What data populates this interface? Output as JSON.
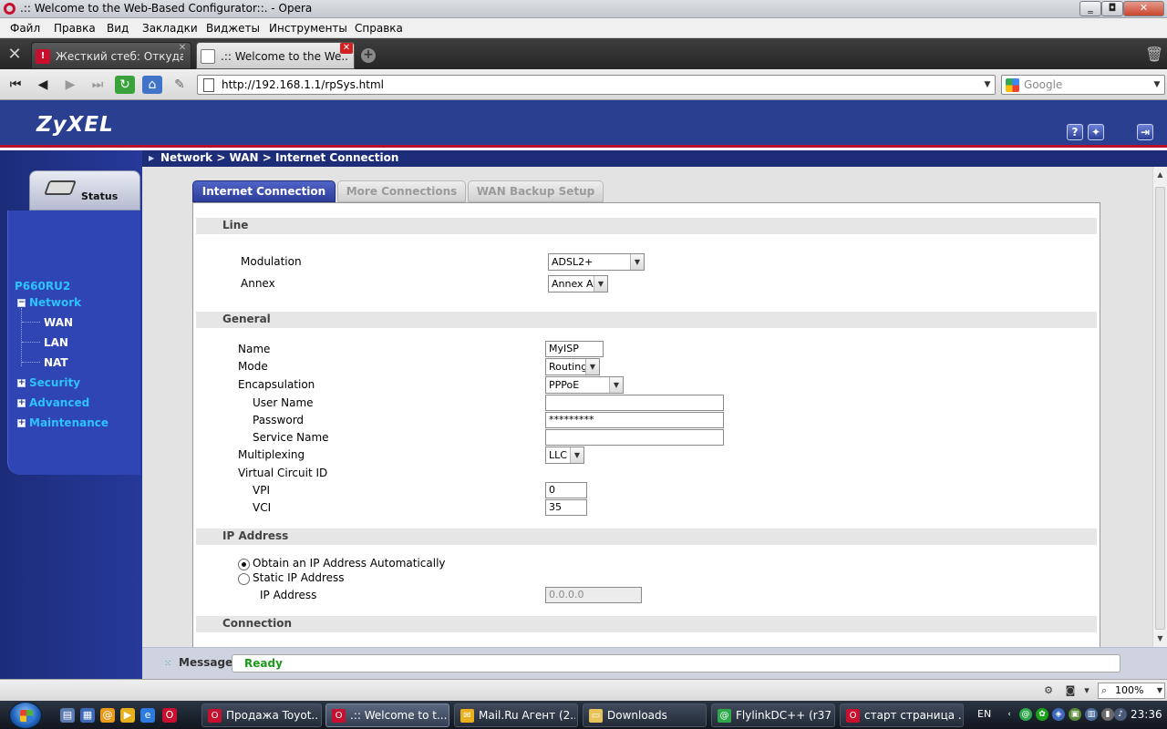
{
  "window": {
    "title": ".:: Welcome to the Web-Based Configurator::. - Opera",
    "min_label": "‗",
    "max_label": "◘",
    "close_label": "✕"
  },
  "menu": [
    "Файл",
    "Правка",
    "Вид",
    "Закладки",
    "Виджеты",
    "Инструменты",
    "Справка"
  ],
  "tabs": [
    {
      "label": "Жесткий стеб: Откуда...",
      "favicon": "!",
      "close": "✕"
    },
    {
      "label": ".:: Welcome to the We...",
      "close": "✕"
    }
  ],
  "address": {
    "url": "http://192.168.1.1/rpSys.html",
    "search_placeholder": "Google"
  },
  "router": {
    "brand": "ZyXEL",
    "status_label": "Status",
    "model": "P660RU2",
    "nav": {
      "network": "Network",
      "wan": "WAN",
      "lan": "LAN",
      "nat": "NAT",
      "security": "Security",
      "advanced": "Advanced",
      "maintenance": "Maintenance"
    },
    "breadcrumb": "Network > WAN > Internet Connection",
    "page_tabs": [
      "Internet Connection",
      "More Connections",
      "WAN Backup Setup"
    ],
    "sections": {
      "line": "Line",
      "general": "General",
      "ip": "IP Address",
      "connection": "Connection"
    },
    "line": {
      "modulation_label": "Modulation",
      "modulation_value": "ADSL2+",
      "annex_label": "Annex",
      "annex_value": "Annex A"
    },
    "general": {
      "name_label": "Name",
      "name_value": "MyISP",
      "mode_label": "Mode",
      "mode_value": "Routing",
      "encap_label": "Encapsulation",
      "encap_value": "PPPoE",
      "username_label": "User Name",
      "username_value": "",
      "password_label": "Password",
      "password_value": "*********",
      "service_label": "Service Name",
      "service_value": "",
      "mux_label": "Multiplexing",
      "mux_value": "LLC",
      "vc_label": "Virtual Circuit ID",
      "vpi_label": "VPI",
      "vpi_value": "0",
      "vci_label": "VCI",
      "vci_value": "35"
    },
    "ip": {
      "auto_label": "Obtain an IP Address Automatically",
      "static_label": "Static IP Address",
      "ipaddr_label": "IP Address",
      "ipaddr_value": "0.0.0.0"
    },
    "message": {
      "label": "Message",
      "text": "Ready"
    }
  },
  "opera_status": {
    "zoom": "100%"
  },
  "taskbar": {
    "items": [
      {
        "label": "Продажа Toyot...",
        "icon": "opera-icon"
      },
      {
        "label": ".:: Welcome to t...",
        "icon": "opera-icon"
      },
      {
        "label": "Mail.Ru Агент (2...",
        "icon": "mail-agent-icon"
      },
      {
        "label": "Downloads",
        "icon": "folder-icon"
      },
      {
        "label": "FlylinkDC++ (r37...",
        "icon": "flylink-icon"
      },
      {
        "label": "старт страница ...",
        "icon": "opera-icon"
      }
    ],
    "lang": "EN",
    "clock": "23:36"
  }
}
